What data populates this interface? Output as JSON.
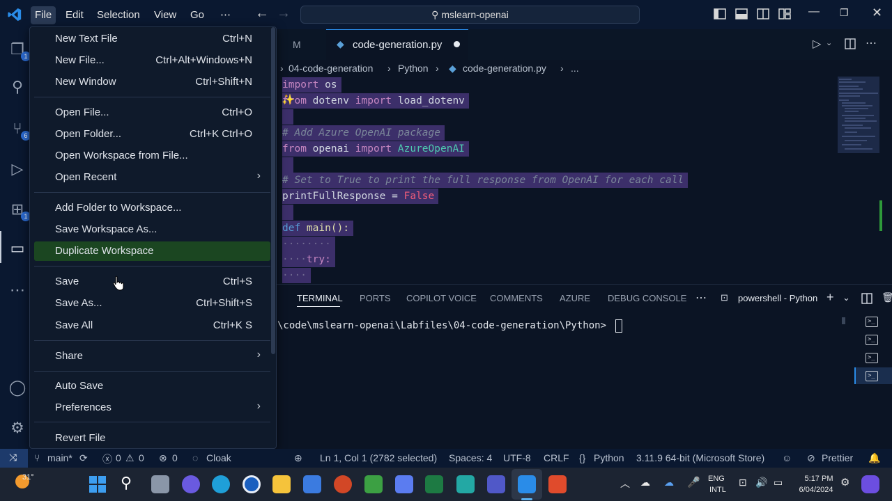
{
  "titlebar": {
    "menus": [
      "File",
      "Edit",
      "Selection",
      "View",
      "Go",
      "⋯"
    ],
    "search_text": "mslearn-openai"
  },
  "activity_badges": [
    "1",
    "6",
    "1"
  ],
  "tabs": {
    "inactive_label": "M",
    "active_label": "code-generation.py"
  },
  "breadcrumb": {
    "folder": "04-code-generation",
    "sub": "Python",
    "file": "code-generation.py",
    "more": "..."
  },
  "code": [
    {
      "text": "import os"
    },
    {
      "text": "from dotenv import load_dotenv"
    },
    {
      "text": ""
    },
    {
      "text": "# Add Azure OpenAI package"
    },
    {
      "text": "from openai import AzureOpenAI"
    },
    {
      "text": ""
    },
    {
      "text": "# Set to True to print the full response from OpenAI for each call"
    },
    {
      "text": "printFullResponse = False"
    },
    {
      "text": ""
    },
    {
      "text": "def main():"
    },
    {
      "text": "........"
    },
    {
      "text": "....try:"
    },
    {
      "text": "...."
    }
  ],
  "code_tokens": {
    "l1a": "import",
    "l1b": " os",
    "l2a": "from",
    "l2b": " dotenv ",
    "l2c": "import",
    "l2d": " load_dotenv",
    "l4": "# Add Azure OpenAI package",
    "l5a": "from",
    "l5b": " openai ",
    "l5c": "import",
    "l5d": " AzureOpenAI",
    "l7": "# Set to True to print the full response from OpenAI for each call",
    "l8a": "printFullResponse",
    "l8b": " = ",
    "l8c": "False",
    "l10a": "def",
    "l10b": " main",
    "l10c": "():",
    "l11": "········",
    "l12a": "····",
    "l12b": "try:",
    "l13": "····"
  },
  "panel": {
    "tabs": [
      "TERMINAL",
      "PORTS",
      "COPILOT VOICE",
      "COMMENTS",
      "AZURE",
      "DEBUG CONSOLE"
    ],
    "more": "⋯",
    "terminal_name": "powershell - Python",
    "prompt": "\\code\\mslearn-openai\\Labfiles\\04-code-generation\\Python> "
  },
  "file_menu": {
    "items": [
      {
        "label": "New Text File",
        "shortcut": "Ctrl+N"
      },
      {
        "label": "New File...",
        "shortcut": "Ctrl+Alt+Windows+N"
      },
      {
        "label": "New Window",
        "shortcut": "Ctrl+Shift+N"
      },
      {
        "label": "Open File...",
        "shortcut": "Ctrl+O"
      },
      {
        "label": "Open Folder...",
        "shortcut": "Ctrl+K Ctrl+O"
      },
      {
        "label": "Open Workspace from File...",
        "shortcut": ""
      },
      {
        "label": "Open Recent",
        "shortcut": ""
      },
      {
        "label": "Add Folder to Workspace...",
        "shortcut": ""
      },
      {
        "label": "Save Workspace As...",
        "shortcut": ""
      },
      {
        "label": "Duplicate Workspace",
        "shortcut": ""
      },
      {
        "label": "Save",
        "shortcut": "Ctrl+S"
      },
      {
        "label": "Save As...",
        "shortcut": "Ctrl+Shift+S"
      },
      {
        "label": "Save All",
        "shortcut": "Ctrl+K S"
      },
      {
        "label": "Share",
        "shortcut": ""
      },
      {
        "label": "Auto Save",
        "shortcut": ""
      },
      {
        "label": "Preferences",
        "shortcut": ""
      },
      {
        "label": "Revert File",
        "shortcut": ""
      }
    ]
  },
  "statusbar": {
    "branch": "main*",
    "errors": "0",
    "warnings": "0",
    "ports": "0",
    "cloak": "Cloak",
    "position": "Ln 1, Col 1 (2782 selected)",
    "spaces": "Spaces: 4",
    "encoding": "UTF-8",
    "eol": "CRLF",
    "language": "Python",
    "interpreter": "3.11.9 64-bit (Microsoft Store)",
    "prettier": "Prettier"
  },
  "taskbar": {
    "weather": "31°",
    "lang1": "ENG",
    "lang2": "INTL",
    "time": "5:17 PM",
    "date": "6/04/2024"
  },
  "colors": {
    "selection": "#3c2f6a",
    "menu_highlight": "#1b4621",
    "accent_blue": "#2b6ad0"
  }
}
